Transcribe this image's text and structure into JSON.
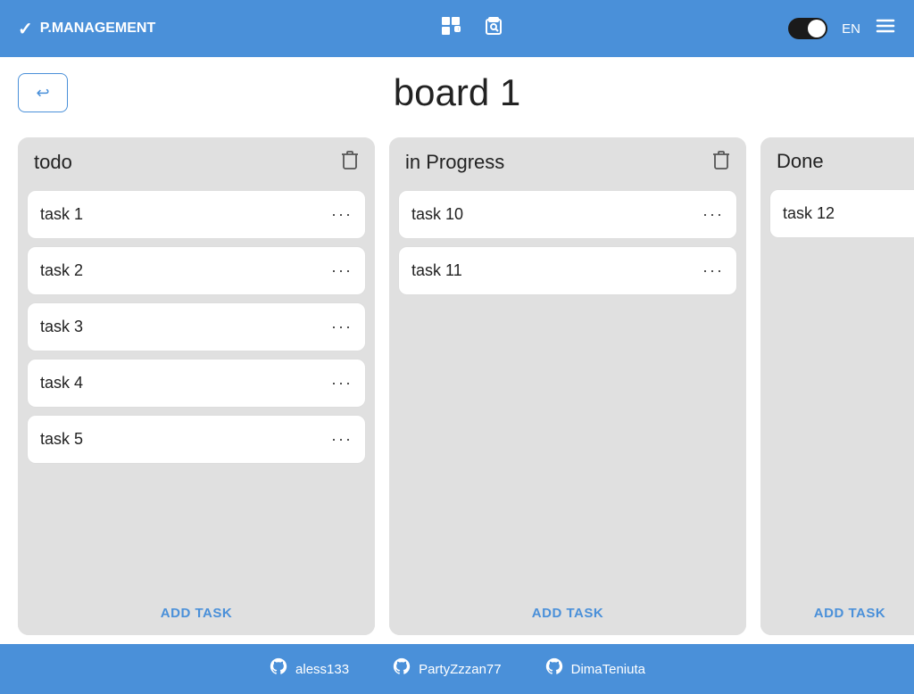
{
  "header": {
    "logo": "P.MANAGEMENT",
    "check_symbol": "✓",
    "lang": "EN",
    "add_board_icon": "⊞",
    "search_icon": "🔍",
    "menu_icon": "≡"
  },
  "page": {
    "back_label": "↩",
    "title": "board 1"
  },
  "columns": [
    {
      "id": "todo",
      "title": "todo",
      "tasks": [
        {
          "name": "task 1"
        },
        {
          "name": "task 2"
        },
        {
          "name": "task 3"
        },
        {
          "name": "task 4"
        },
        {
          "name": "task 5"
        }
      ],
      "add_label": "ADD TASK"
    },
    {
      "id": "in-progress",
      "title": "in Progress",
      "tasks": [
        {
          "name": "task 10"
        },
        {
          "name": "task 11"
        }
      ],
      "add_label": "ADD TASK"
    },
    {
      "id": "done",
      "title": "Done",
      "tasks": [
        {
          "name": "task 12"
        }
      ],
      "add_label": "ADD TASK"
    }
  ],
  "footer": {
    "users": [
      {
        "name": "aless133"
      },
      {
        "name": "PartyZzzan77"
      },
      {
        "name": "DimaTeniuta"
      }
    ]
  },
  "icons": {
    "task_menu": "•••",
    "delete": "🗑",
    "github": "⬤"
  }
}
